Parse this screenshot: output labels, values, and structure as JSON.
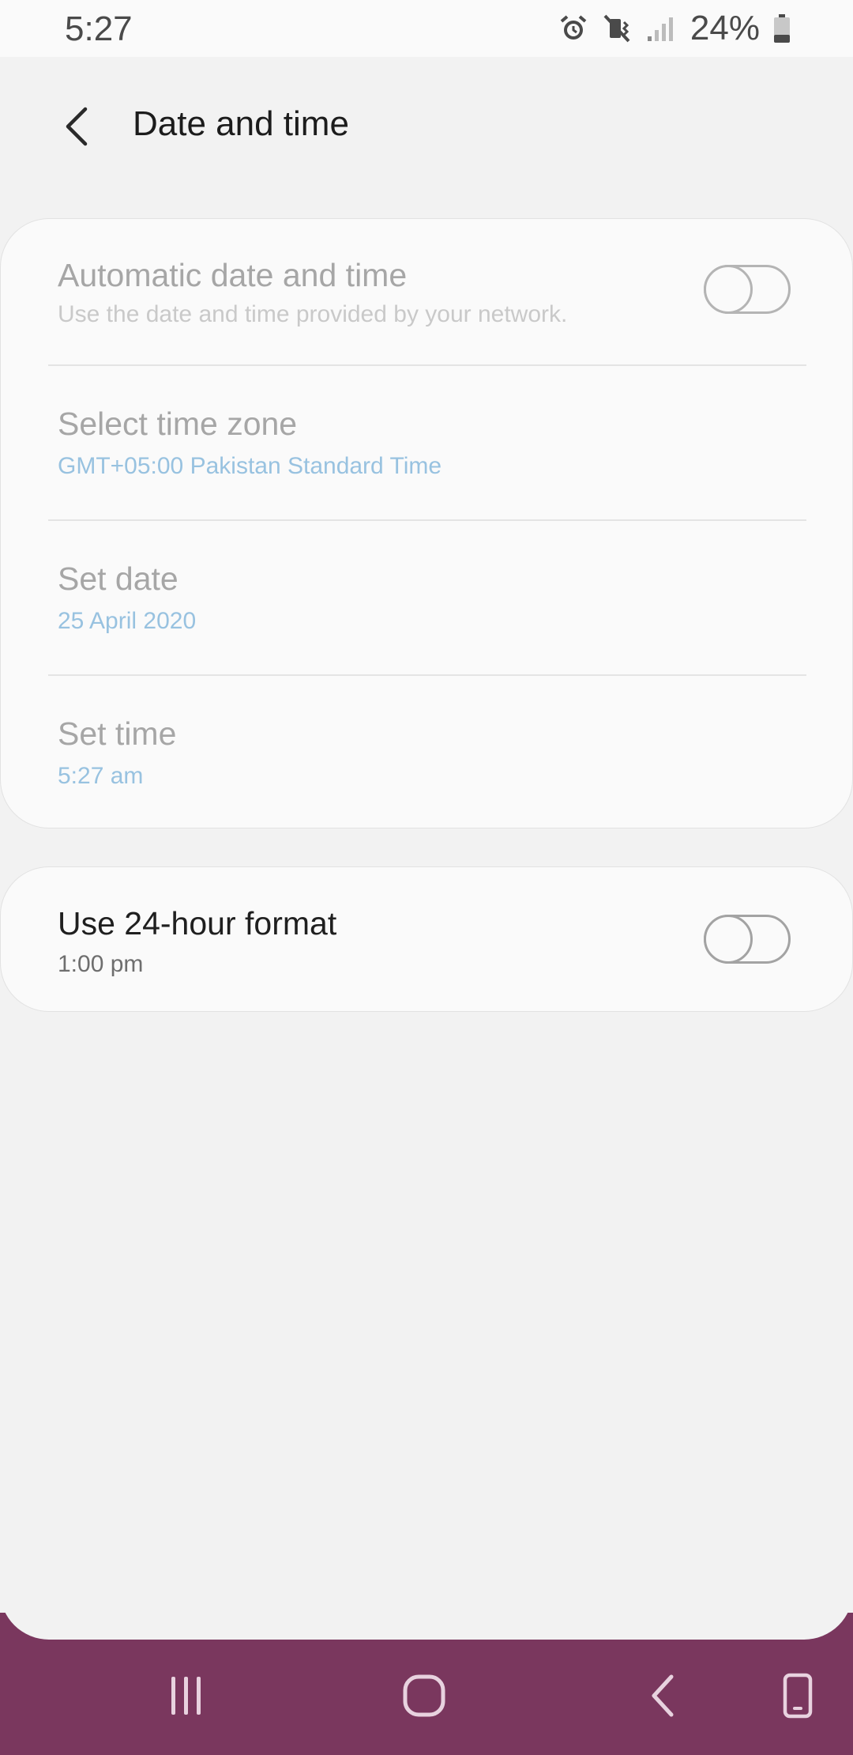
{
  "status_bar": {
    "time": "5:27",
    "battery": "24%",
    "icons": [
      "alarm-icon",
      "vibrate-mute-icon",
      "signal-icon",
      "battery-icon"
    ]
  },
  "header": {
    "title": "Date and time",
    "back_icon": "back-arrow-icon"
  },
  "settings": {
    "auto": {
      "title": "Automatic date and time",
      "subtitle": "Use the date and time provided by your network.",
      "toggle_on": false
    },
    "timezone": {
      "title": "Select time zone",
      "value": "GMT+05:00 Pakistan Standard Time"
    },
    "date": {
      "title": "Set date",
      "value": "25 April 2020"
    },
    "time": {
      "title": "Set time",
      "value": "5:27 am"
    },
    "format24": {
      "title": "Use 24-hour format",
      "value": "1:00 pm",
      "toggle_on": false
    }
  },
  "nav_bar": {
    "color": "#7a375e",
    "buttons": [
      "recents-icon",
      "home-icon",
      "back-icon",
      "keyboard-switch-icon"
    ]
  },
  "colors": {
    "accent_value": "#98c2e0",
    "background": "#f2f2f2"
  }
}
